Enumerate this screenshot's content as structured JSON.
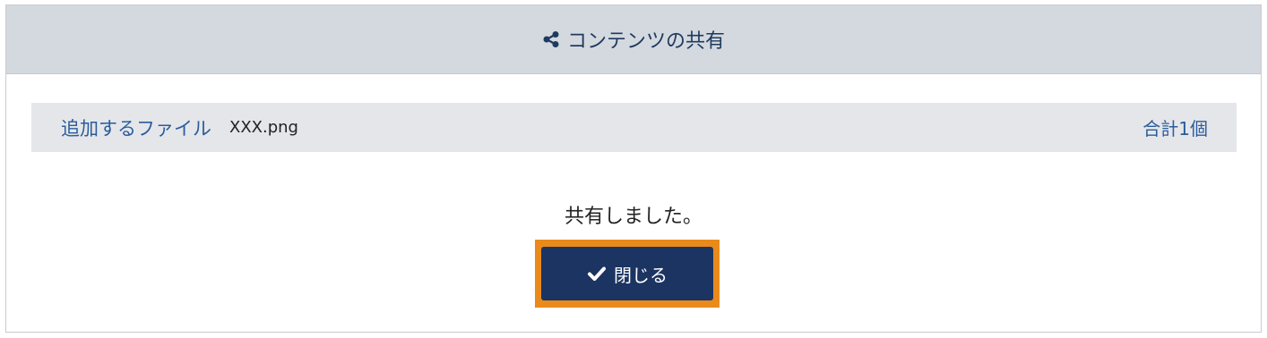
{
  "dialog": {
    "title": "コンテンツの共有",
    "title_icon": "share-icon"
  },
  "file_bar": {
    "label": "追加するファイル",
    "file_name": "XXX.png",
    "total": "合計1個"
  },
  "message": "共有しました。",
  "close_button": {
    "label": "閉じる",
    "icon": "check-icon"
  },
  "colors": {
    "header_bg": "#d4d9df",
    "title_text": "#1e3a5f",
    "file_bar_bg": "#e4e6ea",
    "accent_text": "#2b5c9a",
    "button_bg": "#1c3462",
    "focus_ring": "#ea8a1b"
  }
}
